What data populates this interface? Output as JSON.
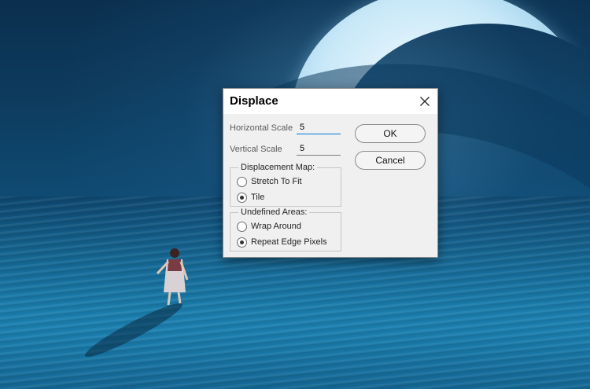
{
  "dialog": {
    "title": "Displace",
    "horizontal_scale_label": "Horizontal Scale",
    "horizontal_scale_value": "5",
    "vertical_scale_label": "Vertical Scale",
    "vertical_scale_value": "5",
    "ok_label": "OK",
    "cancel_label": "Cancel",
    "displacement_map": {
      "legend": "Displacement Map:",
      "options": [
        "Stretch To Fit",
        "Tile"
      ],
      "selected": "Tile"
    },
    "undefined_areas": {
      "legend": "Undefined Areas:",
      "options": [
        "Wrap Around",
        "Repeat Edge Pixels"
      ],
      "selected": "Repeat Edge Pixels"
    }
  },
  "colors": {
    "accent": "#0078d7",
    "dialog_bg": "#f0f0f0"
  },
  "icons": {
    "close": "close-icon"
  }
}
